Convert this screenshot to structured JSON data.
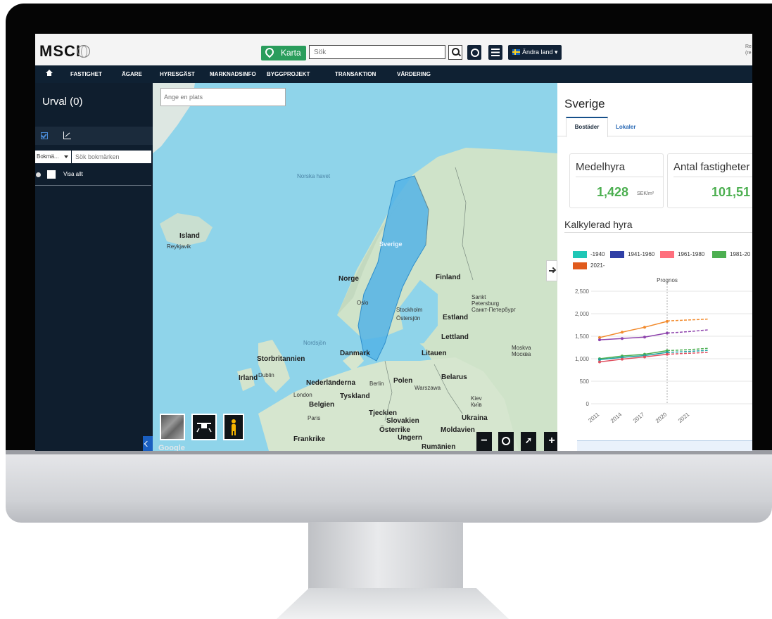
{
  "topbar": {
    "logo": "MSCI",
    "karta_label": "Karta",
    "search_placeholder": "Sök",
    "change_country_label": "Ändra land ▾",
    "user_text": "Re\n(re"
  },
  "nav": {
    "items": [
      "FASTIGHET",
      "ÄGARE",
      "HYRESGÄST",
      "MARKNADSINFO",
      "BYGGPROJEKT",
      "TRANSAKTION",
      "VÄRDERING"
    ]
  },
  "sidebar": {
    "title": "Urval (0)",
    "bookmark_select": "Bokmä...",
    "bookmark_search_placeholder": "Sök bokmärken",
    "show_all_label": "Visa allt"
  },
  "map": {
    "place_placeholder": "Ange en plats",
    "labels": {
      "norska_havet": "Norska havet",
      "island": "Island",
      "reykjavik": "Reykjavik",
      "sverige": "Sverige",
      "norge": "Norge",
      "finland": "Finland",
      "oslo": "Oslo",
      "stockholm": "Stockholm",
      "ostersjon": "Östersjön",
      "sankt_petersburg": "Sankt\nPetersburg\nСанкт-Петербург",
      "estland": "Estland",
      "lettland": "Lettland",
      "nordsjon": "Nordsjön",
      "danmark": "Danmark",
      "litauen": "Litauen",
      "moskva": "Moskva\nМосква",
      "storbritannien": "Storbritannien",
      "irland": "Irland",
      "dublin": "Dublin",
      "nederlanderna": "Nederländerna",
      "berlin": "Berlin",
      "polen": "Polen",
      "warszawa": "Warszawa",
      "belarus": "Belarus",
      "london": "London",
      "tyskland": "Tyskland",
      "belgien": "Belgien",
      "kiev": "Kiev\nКиїв",
      "tjeckien": "Tjeckien",
      "slovakien": "Slovakien",
      "ukraina": "Ukraina",
      "paris": "Paris",
      "osterrike": "Österrike",
      "moldavien": "Moldavien",
      "frankrike": "Frankrike",
      "ungern": "Ungern",
      "rumanien": "Rumänien",
      "google": "Google"
    }
  },
  "panel": {
    "title": "Sverige",
    "tabs": [
      "Bostäder",
      "Lokaler"
    ],
    "card1": {
      "label": "Medelhyra",
      "value": "1,428",
      "unit": "SEK/m²"
    },
    "card2": {
      "label": "Antal fastigheter",
      "value": "101,51"
    },
    "chart_title": "Kalkylerad hyra"
  },
  "chart_data": {
    "type": "line",
    "title": "Kalkylerad hyra",
    "annotation": "Prognos",
    "categories": [
      "2011",
      "2014",
      "2017",
      "2020",
      "2021"
    ],
    "y_ticks": [
      "2,500",
      "2,000",
      "1,500",
      "1,000",
      "500",
      "0"
    ],
    "ylim": [
      0,
      2500
    ],
    "legend": [
      "-1940",
      "1941-1960",
      "1961-1980",
      "1981-20",
      "2021-"
    ],
    "legend_colors": [
      "#1fc7b6",
      "#2f3fa6",
      "#ff6f7d",
      "#4caf50",
      "#e05a1c"
    ],
    "series": [
      {
        "color": "#f28a2c",
        "values": [
          1470,
          1590,
          1700,
          1830,
          1860
        ],
        "forecast_values": [
          1840,
          1860,
          1880
        ]
      },
      {
        "color": "#8e44ad",
        "values": [
          1420,
          1450,
          1480,
          1570,
          1600
        ],
        "forecast_values": [
          1570,
          1600,
          1640
        ]
      },
      {
        "color": "#4caf50",
        "values": [
          1000,
          1060,
          1100,
          1180,
          1200
        ],
        "forecast_values": [
          1180,
          1200,
          1230
        ]
      },
      {
        "color": "#20a0a0",
        "values": [
          980,
          1030,
          1070,
          1140,
          1160
        ],
        "forecast_values": [
          1140,
          1160,
          1185
        ]
      },
      {
        "color": "#e05060",
        "values": [
          930,
          990,
          1040,
          1100,
          1120
        ],
        "forecast_values": [
          1100,
          1120,
          1140
        ]
      }
    ]
  }
}
